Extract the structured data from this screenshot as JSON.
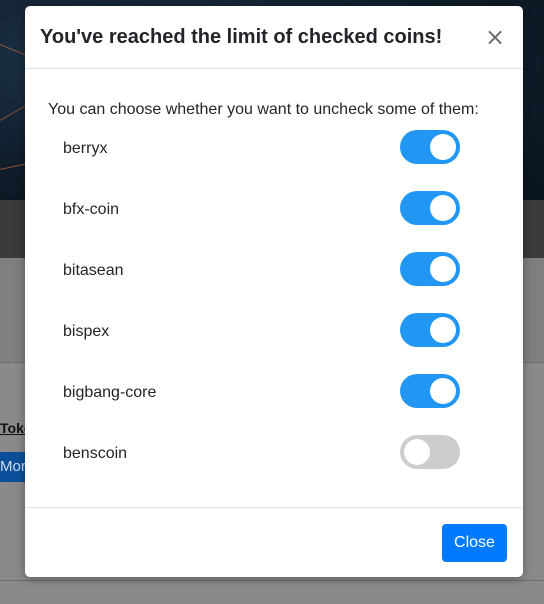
{
  "background": {
    "token_text": "Toke",
    "more_text": "More"
  },
  "modal": {
    "title": "You've reached the limit of checked coins!",
    "close_x": "×",
    "intro": "You can choose whether you want to uncheck some of them:",
    "coins": [
      {
        "name": "berryx",
        "checked": true
      },
      {
        "name": "bfx-coin",
        "checked": true
      },
      {
        "name": "bitasean",
        "checked": true
      },
      {
        "name": "bispex",
        "checked": true
      },
      {
        "name": "bigbang-core",
        "checked": true
      },
      {
        "name": "benscoin",
        "checked": false
      }
    ],
    "close_button": "Close"
  },
  "colors": {
    "toggle_on": "#2196f3",
    "toggle_off": "#cccccc",
    "primary_button": "#007bff"
  }
}
